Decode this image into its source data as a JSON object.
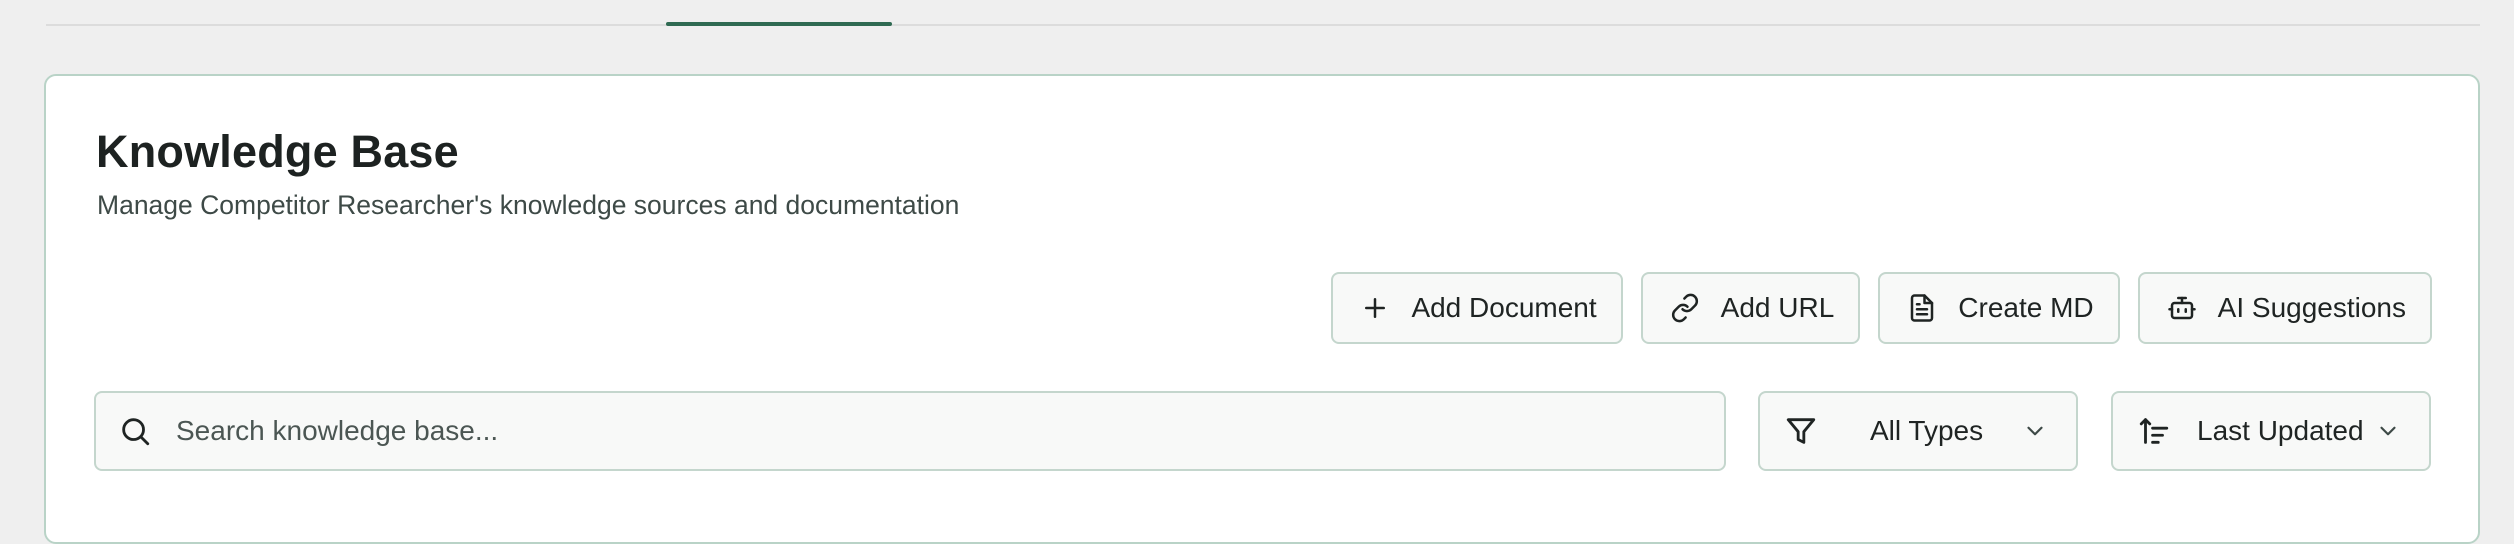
{
  "header": {
    "title": "Knowledge Base",
    "subtitle": "Manage Competitor Researcher's knowledge sources and documentation"
  },
  "actions": [
    {
      "label": "Add Document",
      "icon": "plus-icon"
    },
    {
      "label": "Add URL",
      "icon": "link-icon"
    },
    {
      "label": "Create MD",
      "icon": "document-icon"
    },
    {
      "label": "AI Suggestions",
      "icon": "robot-icon"
    }
  ],
  "search": {
    "placeholder": "Search knowledge base...",
    "value": ""
  },
  "filters": {
    "type": {
      "selected": "All Types",
      "icon": "filter-icon"
    },
    "sort": {
      "selected": "Last Updated",
      "icon": "sort-icon"
    }
  },
  "colors": {
    "accent": "#2f6a52",
    "border": "#c4d6cd",
    "card_border": "#b9d3c7",
    "page_bg": "#efefef"
  }
}
